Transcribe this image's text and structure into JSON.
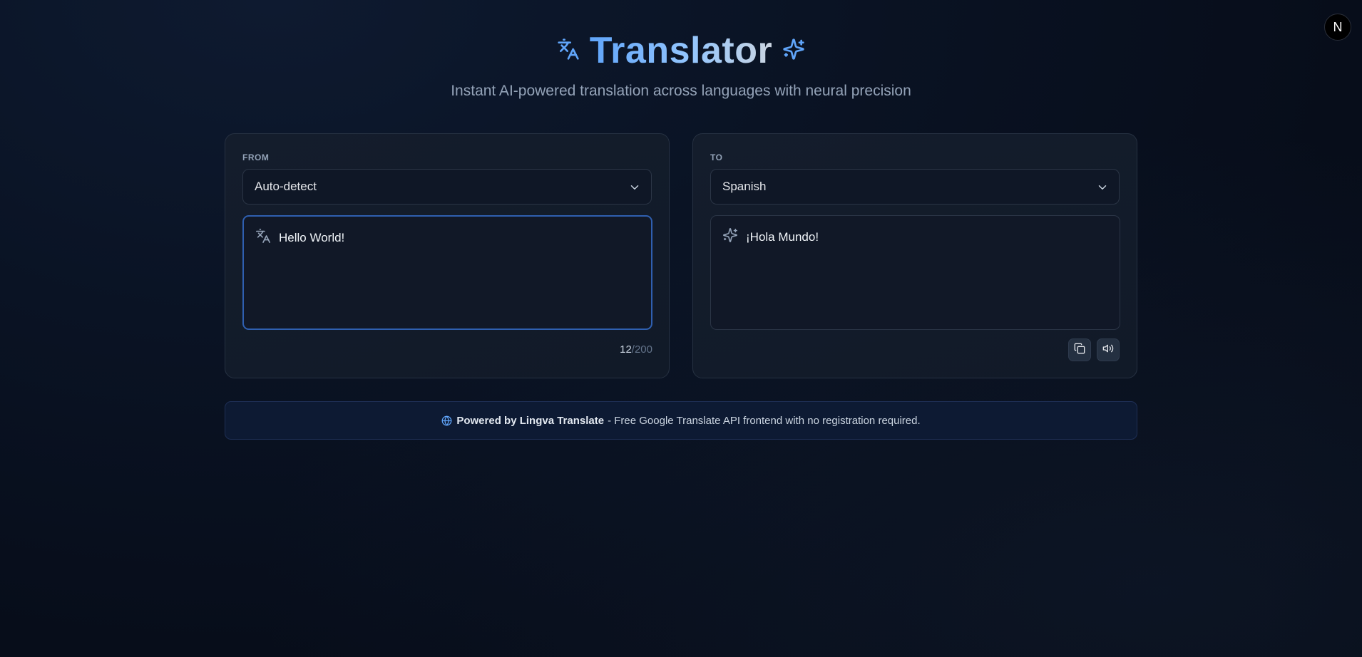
{
  "header": {
    "title": "Translator",
    "subtitle": "Instant AI-powered translation across languages with neural precision",
    "left_icon": "translate-icon",
    "right_icon": "sparkles-icon"
  },
  "avatar": {
    "letter": "N"
  },
  "source": {
    "label": "FROM",
    "language": "Auto-detect",
    "text": "Hello World!",
    "count": "12",
    "limit": "/200",
    "icon": "translate-icon"
  },
  "target": {
    "label": "TO",
    "language": "Spanish",
    "text": "¡Hola Mundo!",
    "icon": "sparkles-icon",
    "copy_icon": "copy-icon",
    "speak_icon": "speaker-icon"
  },
  "footer": {
    "icon": "globe-icon",
    "strong": "Powered by Lingva Translate",
    "rest": "- Free Google Translate API frontend with no registration required."
  },
  "colors": {
    "accent": "#60a5fa",
    "background": "#070d1a",
    "card": "#131c2a",
    "active_border": "#2f5fb0"
  }
}
